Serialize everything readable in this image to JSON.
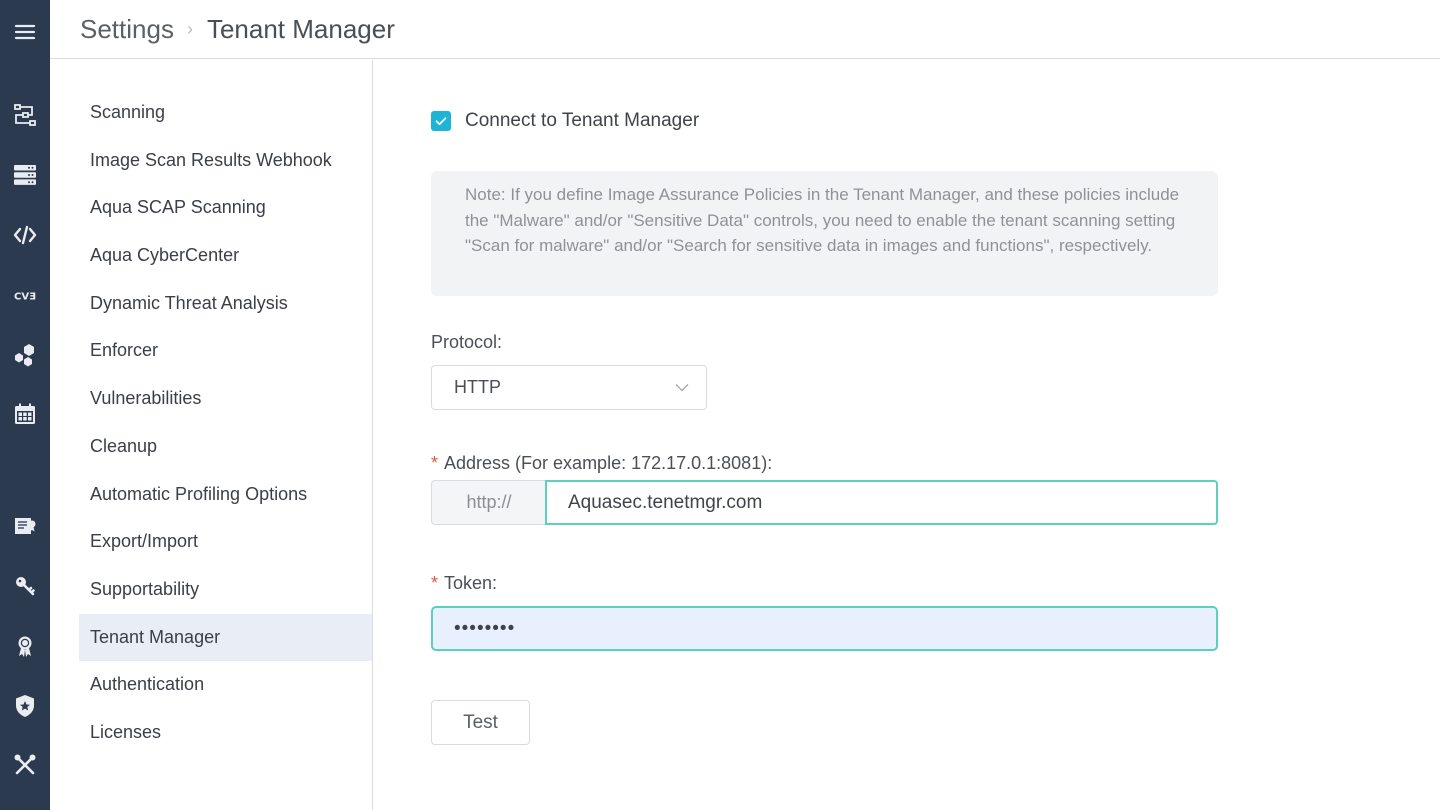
{
  "rail": {
    "icons": [
      {
        "name": "menu-icon"
      },
      {
        "name": "workflow-icon"
      },
      {
        "name": "servers-icon"
      },
      {
        "name": "code-icon"
      },
      {
        "name": "cve-icon",
        "text": "CVE"
      },
      {
        "name": "hexagons-icon"
      },
      {
        "name": "calendar-icon"
      },
      {
        "name": "certificate-doc-icon"
      },
      {
        "name": "key-icon"
      },
      {
        "name": "award-icon"
      },
      {
        "name": "shield-icon"
      },
      {
        "name": "tools-icon"
      }
    ]
  },
  "header": {
    "breadcrumb_root": "Settings",
    "breadcrumb_current": "Tenant Manager"
  },
  "nav": {
    "items": [
      {
        "label": "Scanning",
        "active": false
      },
      {
        "label": "Image Scan Results Webhook",
        "active": false
      },
      {
        "label": "Aqua SCAP Scanning",
        "active": false
      },
      {
        "label": "Aqua CyberCenter",
        "active": false
      },
      {
        "label": "Dynamic Threat Analysis",
        "active": false
      },
      {
        "label": "Enforcer",
        "active": false
      },
      {
        "label": "Vulnerabilities",
        "active": false
      },
      {
        "label": "Cleanup",
        "active": false
      },
      {
        "label": "Automatic Profiling Options",
        "active": false
      },
      {
        "label": "Export/Import",
        "active": false
      },
      {
        "label": "Supportability",
        "active": false
      },
      {
        "label": "Tenant Manager",
        "active": true
      },
      {
        "label": "Authentication",
        "active": false
      },
      {
        "label": "Licenses",
        "active": false
      }
    ]
  },
  "form": {
    "connect_label": "Connect to Tenant Manager",
    "connect_checked": true,
    "note": "Note: If you define Image Assurance Policies in the Tenant Manager, and these policies include the \"Malware\" and/or \"Sensitive Data\" controls, you need to enable the tenant scanning setting \"Scan for malware\" and/or \"Search for sensitive data in images and functions\", respectively.",
    "protocol_label": "Protocol:",
    "protocol_value": "HTTP",
    "required_mark": "*",
    "address_label": "Address (For example: 172.17.0.1:8081):",
    "address_prefix": "http://",
    "address_value": "Aquasec.tenetmgr.com",
    "token_label": "Token:",
    "token_value": "••••••••",
    "test_button": "Test"
  },
  "colors": {
    "rail_bg": "#2b3a4f",
    "accent_checkbox": "#1fb3d6",
    "input_focus_border": "#5ccfbd",
    "required": "#e8553a",
    "nav_active_bg": "#e9eef6"
  }
}
